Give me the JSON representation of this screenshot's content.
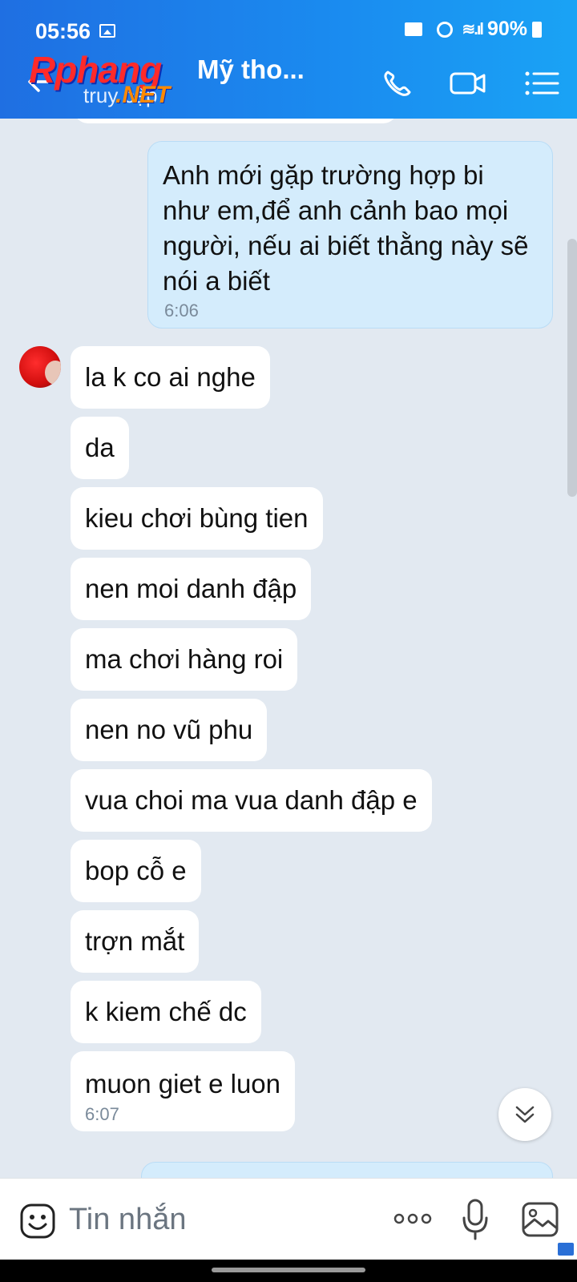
{
  "status_bar": {
    "time": "05:56",
    "battery": "90%"
  },
  "header": {
    "contact_name": "Mỹ tho...",
    "status": "truy cập",
    "watermark_line1": "Rphang",
    "watermark_line2": ".NET"
  },
  "messages": {
    "outgoing": [
      {
        "text": "Anh mới gặp trường hợp bi như em,để anh cảnh bao mọi người, nếu ai biết thằng này sẽ nói a biết",
        "time": "6:06"
      }
    ],
    "incoming": [
      {
        "text": "la k co ai nghe"
      },
      {
        "text": "da"
      },
      {
        "text": "kieu chơi bùng tien"
      },
      {
        "text": "nen moi danh đập"
      },
      {
        "text": "ma chơi hàng roi"
      },
      {
        "text": "nen no vũ phu"
      },
      {
        "text": "vua choi ma vua danh đập e"
      },
      {
        "text": "bop cỗ e"
      },
      {
        "text": "trợn mắt"
      },
      {
        "text": "k kiem chế dc"
      },
      {
        "text": "muon giet e luon",
        "time": "6:07"
      }
    ]
  },
  "input_bar": {
    "placeholder": "Tin nhắn"
  },
  "icons": {
    "back": "back-arrow-icon",
    "call": "phone-icon",
    "video": "video-camera-icon",
    "menu": "list-menu-icon",
    "emoji": "emoji-icon",
    "more": "more-dots-icon",
    "mic": "microphone-icon",
    "gallery": "image-gallery-icon",
    "scroll": "scroll-down-icon"
  },
  "colors": {
    "header": "#1a8cf0",
    "outgoing_bubble": "#d4ecfc",
    "incoming_bubble": "#ffffff",
    "chat_bg": "#e2e9f1"
  }
}
